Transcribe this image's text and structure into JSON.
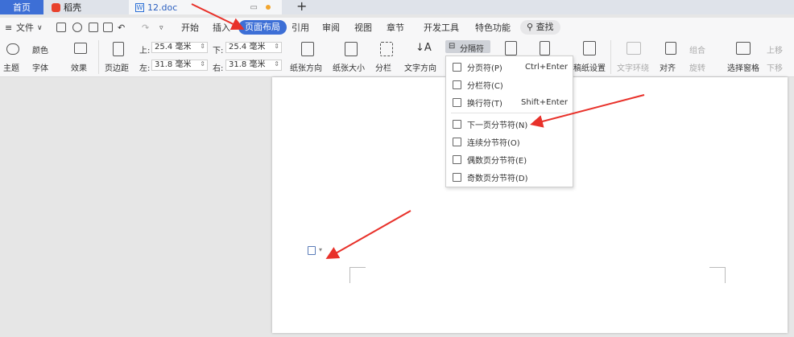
{
  "tabs": {
    "home": "首页",
    "daoke": "稻壳",
    "doc": "12.doc",
    "add": "+"
  },
  "menu": {
    "file": "文件",
    "items": [
      "开始",
      "插入",
      "页面布局",
      "引用",
      "审阅",
      "视图",
      "章节",
      "开发工具",
      "特色功能"
    ],
    "search": "查找"
  },
  "ribbon": {
    "color": "颜色",
    "theme": "主题",
    "font": "字体",
    "effect": "效果",
    "margin": "页边距",
    "top_label": "上:",
    "top_value": "25.4 毫米",
    "bottom_label": "下:",
    "bottom_value": "25.4 毫米",
    "left_label": "左:",
    "left_value": "31.8 毫米",
    "right_label": "右:",
    "right_value": "31.8 毫米",
    "orientation": "纸张方向",
    "size": "纸张大小",
    "columns": "分栏",
    "text_direction": "文字方向",
    "separator": "分隔符",
    "manuscript": "稿纸设置",
    "text_wrap": "文字环绕",
    "align": "对齐",
    "group": "组合",
    "rotate": "旋转",
    "selection_pane": "选择窗格",
    "move_up": "上移",
    "move_down": "下移"
  },
  "dropdown": {
    "items": [
      {
        "label": "分页符(P)",
        "shortcut": "Ctrl+Enter"
      },
      {
        "label": "分栏符(C)",
        "shortcut": ""
      },
      {
        "label": "换行符(T)",
        "shortcut": "Shift+Enter"
      },
      {
        "label": "下一页分节符(N)",
        "shortcut": ""
      },
      {
        "label": "连续分节符(O)",
        "shortcut": ""
      },
      {
        "label": "偶数页分节符(E)",
        "shortcut": ""
      },
      {
        "label": "奇数页分节符(D)",
        "shortcut": ""
      }
    ]
  },
  "colors": {
    "accent": "#3d6fd6",
    "arrow": "#e8312a",
    "daoke_logo": "#e8412c"
  }
}
